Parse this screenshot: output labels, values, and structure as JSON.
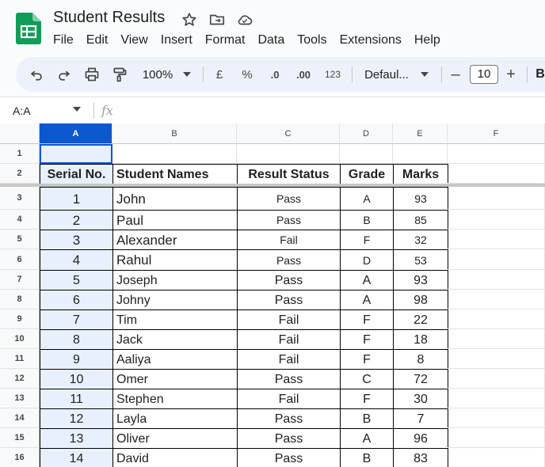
{
  "app": {
    "title": "Student Results",
    "menu": [
      "File",
      "Edit",
      "View",
      "Insert",
      "Format",
      "Data",
      "Tools",
      "Extensions",
      "Help"
    ],
    "accent_color": "#0b57d0",
    "logo_color": "#0f9d58"
  },
  "toolbar": {
    "zoom": "100%",
    "currency": "£",
    "percent": "%",
    "dec_decrease": ".0",
    "dec_increase": ".00",
    "format_123": "123",
    "font": "Defaul...",
    "font_size": "10",
    "minus": "–",
    "plus": "+",
    "bold": "B"
  },
  "formula_bar": {
    "name_box": "A:A",
    "fx": "fx"
  },
  "columns": [
    "A",
    "B",
    "C",
    "D",
    "E",
    "F"
  ],
  "row_numbers": [
    "1",
    "2",
    "3",
    "4",
    "5",
    "6",
    "7",
    "8",
    "9",
    "10",
    "11",
    "12",
    "13",
    "14",
    "15",
    "16"
  ],
  "table": {
    "headers": [
      "Serial No.",
      "Student Names",
      "Result Status",
      "Grade",
      "Marks"
    ],
    "rows": [
      [
        "1",
        "John",
        "Pass",
        "A",
        "93"
      ],
      [
        "2",
        "Paul",
        "Pass",
        "B",
        "85"
      ],
      [
        "3",
        "Alexander",
        "Fail",
        "F",
        "32"
      ],
      [
        "4",
        "Rahul",
        "Pass",
        "D",
        "53"
      ],
      [
        "5",
        "Joseph",
        "Pass",
        "A",
        "93"
      ],
      [
        "6",
        "Johny",
        "Pass",
        "A",
        "98"
      ],
      [
        "7",
        "Tim",
        "Fail",
        "F",
        "22"
      ],
      [
        "8",
        "Jack",
        "Fail",
        "F",
        "18"
      ],
      [
        "9",
        "Aaliya",
        "Fail",
        "F",
        "8"
      ],
      [
        "10",
        "Omer",
        "Pass",
        "C",
        "72"
      ],
      [
        "11",
        "Stephen",
        "Fail",
        "F",
        "30"
      ],
      [
        "12",
        "Layla",
        "Pass",
        "B",
        "7"
      ],
      [
        "13",
        "Oliver",
        "Pass",
        "A",
        "96"
      ],
      [
        "14",
        "David",
        "Pass",
        "B",
        "83"
      ]
    ]
  }
}
